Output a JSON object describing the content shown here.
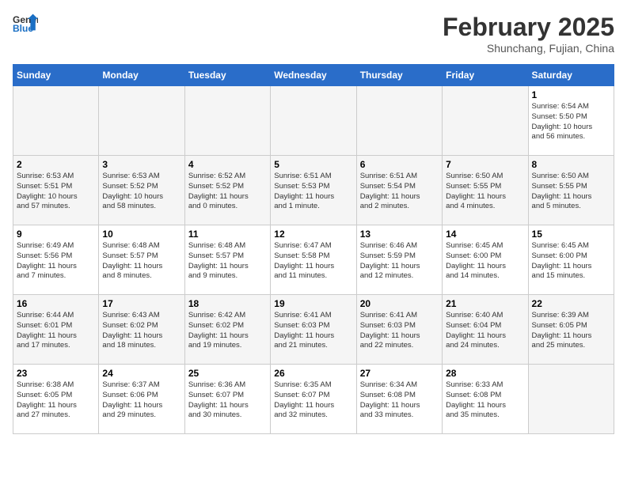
{
  "header": {
    "logo_line1": "General",
    "logo_line2": "Blue",
    "month_title": "February 2025",
    "subtitle": "Shunchang, Fujian, China"
  },
  "days_of_week": [
    "Sunday",
    "Monday",
    "Tuesday",
    "Wednesday",
    "Thursday",
    "Friday",
    "Saturday"
  ],
  "weeks": [
    [
      {
        "day": "",
        "info": ""
      },
      {
        "day": "",
        "info": ""
      },
      {
        "day": "",
        "info": ""
      },
      {
        "day": "",
        "info": ""
      },
      {
        "day": "",
        "info": ""
      },
      {
        "day": "",
        "info": ""
      },
      {
        "day": "1",
        "info": "Sunrise: 6:54 AM\nSunset: 5:50 PM\nDaylight: 10 hours\nand 56 minutes."
      }
    ],
    [
      {
        "day": "2",
        "info": "Sunrise: 6:53 AM\nSunset: 5:51 PM\nDaylight: 10 hours\nand 57 minutes."
      },
      {
        "day": "3",
        "info": "Sunrise: 6:53 AM\nSunset: 5:52 PM\nDaylight: 10 hours\nand 58 minutes."
      },
      {
        "day": "4",
        "info": "Sunrise: 6:52 AM\nSunset: 5:52 PM\nDaylight: 11 hours\nand 0 minutes."
      },
      {
        "day": "5",
        "info": "Sunrise: 6:51 AM\nSunset: 5:53 PM\nDaylight: 11 hours\nand 1 minute."
      },
      {
        "day": "6",
        "info": "Sunrise: 6:51 AM\nSunset: 5:54 PM\nDaylight: 11 hours\nand 2 minutes."
      },
      {
        "day": "7",
        "info": "Sunrise: 6:50 AM\nSunset: 5:55 PM\nDaylight: 11 hours\nand 4 minutes."
      },
      {
        "day": "8",
        "info": "Sunrise: 6:50 AM\nSunset: 5:55 PM\nDaylight: 11 hours\nand 5 minutes."
      }
    ],
    [
      {
        "day": "9",
        "info": "Sunrise: 6:49 AM\nSunset: 5:56 PM\nDaylight: 11 hours\nand 7 minutes."
      },
      {
        "day": "10",
        "info": "Sunrise: 6:48 AM\nSunset: 5:57 PM\nDaylight: 11 hours\nand 8 minutes."
      },
      {
        "day": "11",
        "info": "Sunrise: 6:48 AM\nSunset: 5:57 PM\nDaylight: 11 hours\nand 9 minutes."
      },
      {
        "day": "12",
        "info": "Sunrise: 6:47 AM\nSunset: 5:58 PM\nDaylight: 11 hours\nand 11 minutes."
      },
      {
        "day": "13",
        "info": "Sunrise: 6:46 AM\nSunset: 5:59 PM\nDaylight: 11 hours\nand 12 minutes."
      },
      {
        "day": "14",
        "info": "Sunrise: 6:45 AM\nSunset: 6:00 PM\nDaylight: 11 hours\nand 14 minutes."
      },
      {
        "day": "15",
        "info": "Sunrise: 6:45 AM\nSunset: 6:00 PM\nDaylight: 11 hours\nand 15 minutes."
      }
    ],
    [
      {
        "day": "16",
        "info": "Sunrise: 6:44 AM\nSunset: 6:01 PM\nDaylight: 11 hours\nand 17 minutes."
      },
      {
        "day": "17",
        "info": "Sunrise: 6:43 AM\nSunset: 6:02 PM\nDaylight: 11 hours\nand 18 minutes."
      },
      {
        "day": "18",
        "info": "Sunrise: 6:42 AM\nSunset: 6:02 PM\nDaylight: 11 hours\nand 19 minutes."
      },
      {
        "day": "19",
        "info": "Sunrise: 6:41 AM\nSunset: 6:03 PM\nDaylight: 11 hours\nand 21 minutes."
      },
      {
        "day": "20",
        "info": "Sunrise: 6:41 AM\nSunset: 6:03 PM\nDaylight: 11 hours\nand 22 minutes."
      },
      {
        "day": "21",
        "info": "Sunrise: 6:40 AM\nSunset: 6:04 PM\nDaylight: 11 hours\nand 24 minutes."
      },
      {
        "day": "22",
        "info": "Sunrise: 6:39 AM\nSunset: 6:05 PM\nDaylight: 11 hours\nand 25 minutes."
      }
    ],
    [
      {
        "day": "23",
        "info": "Sunrise: 6:38 AM\nSunset: 6:05 PM\nDaylight: 11 hours\nand 27 minutes."
      },
      {
        "day": "24",
        "info": "Sunrise: 6:37 AM\nSunset: 6:06 PM\nDaylight: 11 hours\nand 29 minutes."
      },
      {
        "day": "25",
        "info": "Sunrise: 6:36 AM\nSunset: 6:07 PM\nDaylight: 11 hours\nand 30 minutes."
      },
      {
        "day": "26",
        "info": "Sunrise: 6:35 AM\nSunset: 6:07 PM\nDaylight: 11 hours\nand 32 minutes."
      },
      {
        "day": "27",
        "info": "Sunrise: 6:34 AM\nSunset: 6:08 PM\nDaylight: 11 hours\nand 33 minutes."
      },
      {
        "day": "28",
        "info": "Sunrise: 6:33 AM\nSunset: 6:08 PM\nDaylight: 11 hours\nand 35 minutes."
      },
      {
        "day": "",
        "info": ""
      }
    ]
  ]
}
